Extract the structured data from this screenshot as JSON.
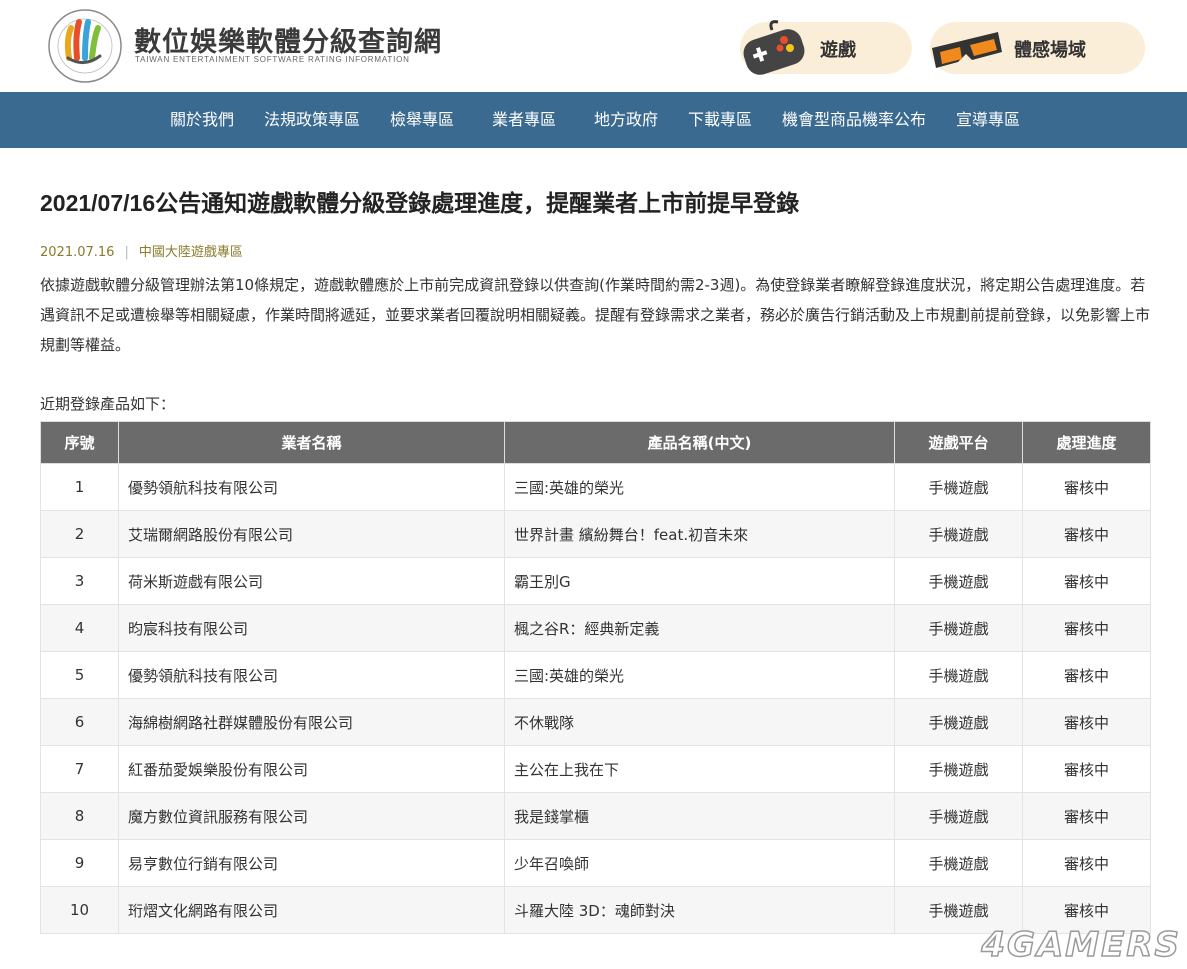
{
  "header": {
    "site_title": "數位娛樂軟體分級查詢網",
    "site_subtitle": "TAIWAN ENTERTAINMENT SOFTWARE RATING INFORMATION",
    "games_label": "遊戲",
    "sense_label": "體感場域"
  },
  "nav": {
    "items": [
      "關於我們",
      "法規政策專區",
      "檢舉專區",
      "業者專區",
      "地方政府",
      "下載專區",
      "機會型商品機率公布",
      "宣導專區"
    ]
  },
  "article": {
    "title": "2021/07/16公告通知遊戲軟體分級登錄處理進度，提醒業者上市前提早登錄",
    "date": "2021.07.16",
    "category": "中國大陸遊戲專區",
    "paragraph": "依據遊戲軟體分級管理辦法第10條規定，遊戲軟體應於上市前完成資訊登錄以供查詢(作業時間約需2-3週)。為使登錄業者瞭解登錄進度狀況，將定期公告處理進度。若遇資訊不足或遭檢舉等相關疑慮，作業時間將遞延，並要求業者回覆說明相關疑義。提醒有登錄需求之業者，務必於廣告行銷活動及上市規劃前提前登錄，以免影響上市規劃等權益。",
    "recent_label": "近期登錄產品如下："
  },
  "table": {
    "headers": [
      "序號",
      "業者名稱",
      "產品名稱(中文)",
      "遊戲平台",
      "處理進度"
    ],
    "rows": [
      [
        "1",
        "優勢領航科技有限公司",
        "三國:英雄的榮光",
        "手機遊戲",
        "審核中"
      ],
      [
        "2",
        "艾瑞爾網路股份有限公司",
        "世界計畫 繽紛舞台！feat.初音未來",
        "手機遊戲",
        "審核中"
      ],
      [
        "3",
        "荷米斯遊戲有限公司",
        "霸王別G",
        "手機遊戲",
        "審核中"
      ],
      [
        "4",
        "昀宸科技有限公司",
        "楓之谷R：經典新定義",
        "手機遊戲",
        "審核中"
      ],
      [
        "5",
        "優勢領航科技有限公司",
        "三國:英雄的榮光",
        "手機遊戲",
        "審核中"
      ],
      [
        "6",
        "海綿樹網路社群媒體股份有限公司",
        "不休戰隊",
        "手機遊戲",
        "審核中"
      ],
      [
        "7",
        "紅番茄愛娛樂股份有限公司",
        "主公在上我在下",
        "手機遊戲",
        "審核中"
      ],
      [
        "8",
        "魔方數位資訊服務有限公司",
        "我是錢掌櫃",
        "手機遊戲",
        "審核中"
      ],
      [
        "9",
        "易亨數位行銷有限公司",
        "少年召喚師",
        "手機遊戲",
        "審核中"
      ],
      [
        "10",
        "珩熠文化網路有限公司",
        "斗羅大陸 3D：魂師對決",
        "手機遊戲",
        "審核中"
      ]
    ]
  },
  "watermark": "4GAMERS",
  "colors": {
    "nav_bg": "#3a6a8f",
    "table_header_bg": "#6b6b6b",
    "pill_bg": "#fbeed8",
    "meta_text": "#8a7a2a"
  }
}
